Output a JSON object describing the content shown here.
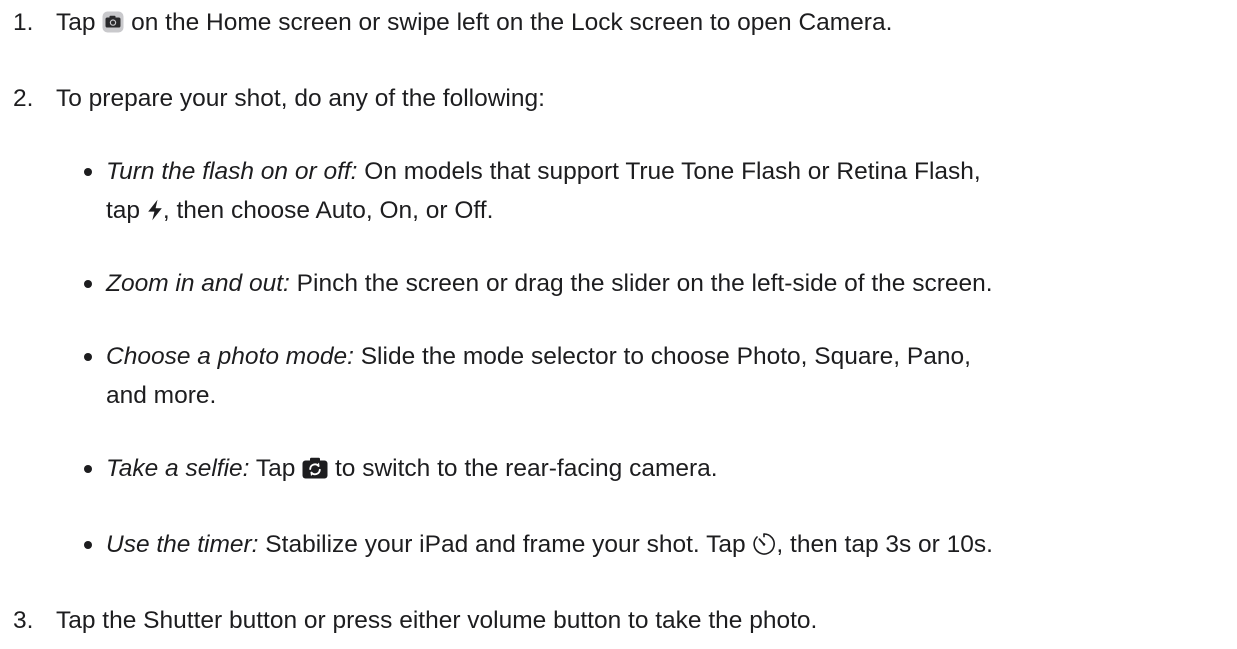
{
  "steps": [
    {
      "number": "1.",
      "before_icon": "Tap ",
      "icon": "camera-app-icon",
      "after_icon": " on the Home screen or swipe left on the Lock screen to open Camera."
    },
    {
      "number": "2.",
      "text": "To prepare your shot, do any of the following:"
    },
    {
      "number": "3.",
      "text": "Tap the Shutter button or press either volume button to take the photo."
    }
  ],
  "bullets": [
    {
      "term": "Turn the flash on or off:",
      "line1": " On models that support True Tone Flash or Retina Flash,",
      "line2_before_icon": "tap ",
      "icon": "flash-icon",
      "line2_after_icon": ", then choose Auto, On, or Off."
    },
    {
      "term": "Zoom in and out:",
      "text": " Pinch the screen or drag the slider on the left-side of the screen."
    },
    {
      "term": "Choose a photo mode:",
      "line1": " Slide the mode selector to choose Photo, Square, Pano,",
      "line2": "and more."
    },
    {
      "term": "Take a selfie:",
      "before_icon": " Tap ",
      "icon": "switch-camera-icon",
      "after_icon": " to switch to the rear-facing camera."
    },
    {
      "term": "Use the timer:",
      "before_icon": " Stabilize your iPad and frame your shot. Tap ",
      "icon": "timer-icon",
      "after_icon": ", then tap 3s or 10s."
    }
  ]
}
